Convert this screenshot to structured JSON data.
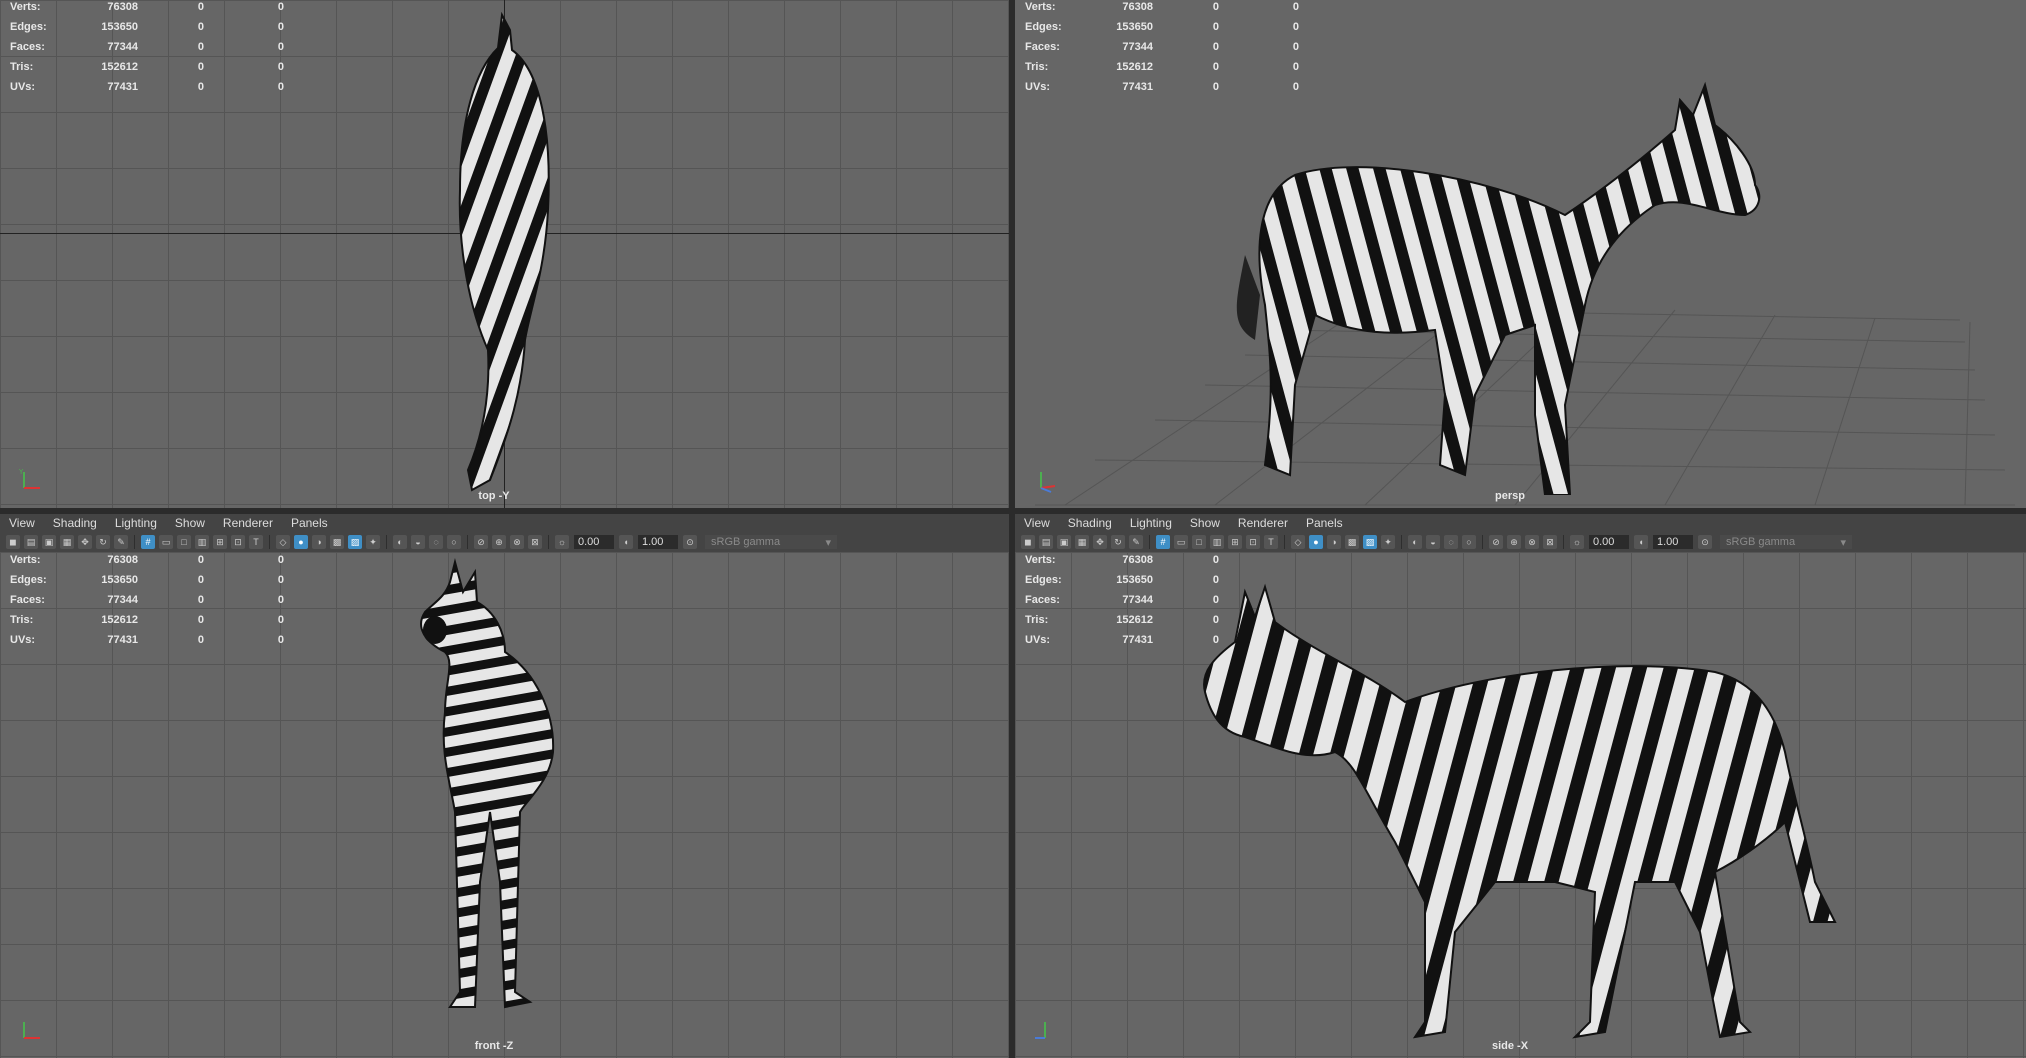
{
  "hud": {
    "verts_label": "Verts:",
    "verts": "76308",
    "edges_label": "Edges:",
    "edges": "153650",
    "faces_label": "Faces:",
    "faces": "77344",
    "tris_label": "Tris:",
    "tris": "152612",
    "uvs_label": "UVs:",
    "uvs": "77431",
    "zero": "0"
  },
  "viewports": {
    "top": {
      "camera": "top -Y"
    },
    "persp": {
      "camera": "persp"
    },
    "front": {
      "camera": "front -Z"
    },
    "side": {
      "camera": "side -X"
    }
  },
  "menu": [
    "View",
    "Shading",
    "Lighting",
    "Show",
    "Renderer",
    "Panels"
  ],
  "toolbar": {
    "exposure": "0.00",
    "gamma": "1.00",
    "color_space": "sRGB gamma"
  },
  "colors": {
    "viewport_bg": "#666666",
    "grid_line": "#555555",
    "toolbar_bg": "#444444",
    "active_icon": "#3f8fc6"
  },
  "icons": [
    "camera-icon",
    "grid-icon",
    "wireframe-icon",
    "shaded-icon",
    "light-icon",
    "isolate-icon"
  ]
}
